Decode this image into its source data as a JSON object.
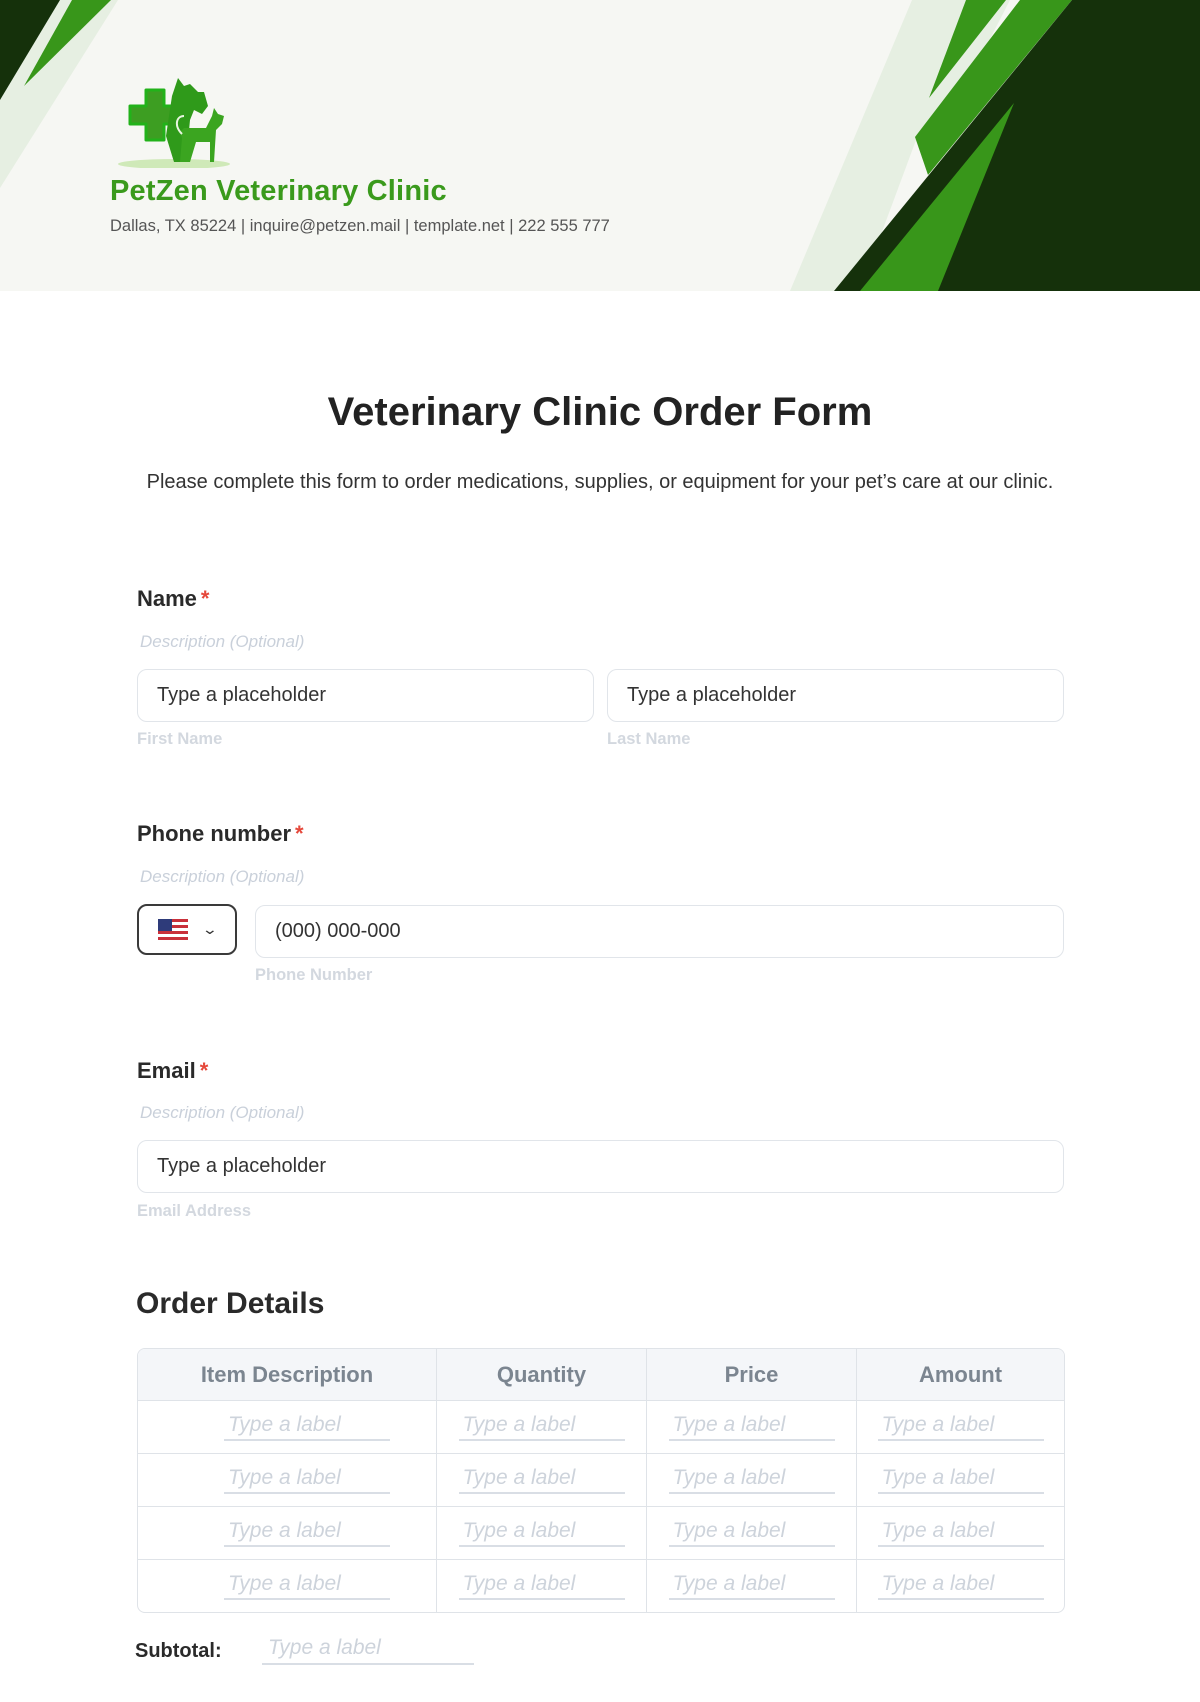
{
  "header": {
    "clinic_name": "PetZen Veterinary Clinic",
    "contact_line": "Dallas, TX 85224 | inquire@petzen.mail | template.net | 222 555 777",
    "logo_icon": "vet-cross-dog-cat-logo",
    "colors": {
      "brand_green": "#3a9a1c",
      "dark_green": "#15310b",
      "light_green": "#e6efe2",
      "background": "#f6f7f3"
    }
  },
  "form": {
    "title": "Veterinary Clinic Order Form",
    "intro": "Please complete this form to order medications, supplies, or equipment for your pet’s care at our clinic.",
    "required_marker": "*",
    "fields": {
      "name": {
        "label": "Name",
        "description": "Description (Optional)",
        "first_placeholder": "Type a placeholder",
        "first_sublabel": "First Name",
        "last_placeholder": "Type a placeholder",
        "last_sublabel": "Last Name"
      },
      "phone": {
        "label": "Phone number",
        "description": "Description (Optional)",
        "country_flag": "us-flag-icon",
        "placeholder": "(000) 000-000",
        "sublabel": "Phone Number"
      },
      "email": {
        "label": "Email",
        "description": "Description (Optional)",
        "placeholder": "Type a placeholder",
        "sublabel": "Email Address"
      }
    },
    "order_details": {
      "title": "Order Details",
      "columns": [
        "Item Description",
        "Quantity",
        "Price",
        "Amount"
      ],
      "rows": [
        [
          "Type a label",
          "Type a label",
          "Type a label",
          "Type a label"
        ],
        [
          "Type a label",
          "Type a label",
          "Type a label",
          "Type a label"
        ],
        [
          "Type a label",
          "Type a label",
          "Type a label",
          "Type a label"
        ],
        [
          "Type a label",
          "Type a label",
          "Type a label",
          "Type a label"
        ]
      ],
      "subtotal_label": "Subtotal:",
      "subtotal_placeholder": "Type a label"
    }
  }
}
